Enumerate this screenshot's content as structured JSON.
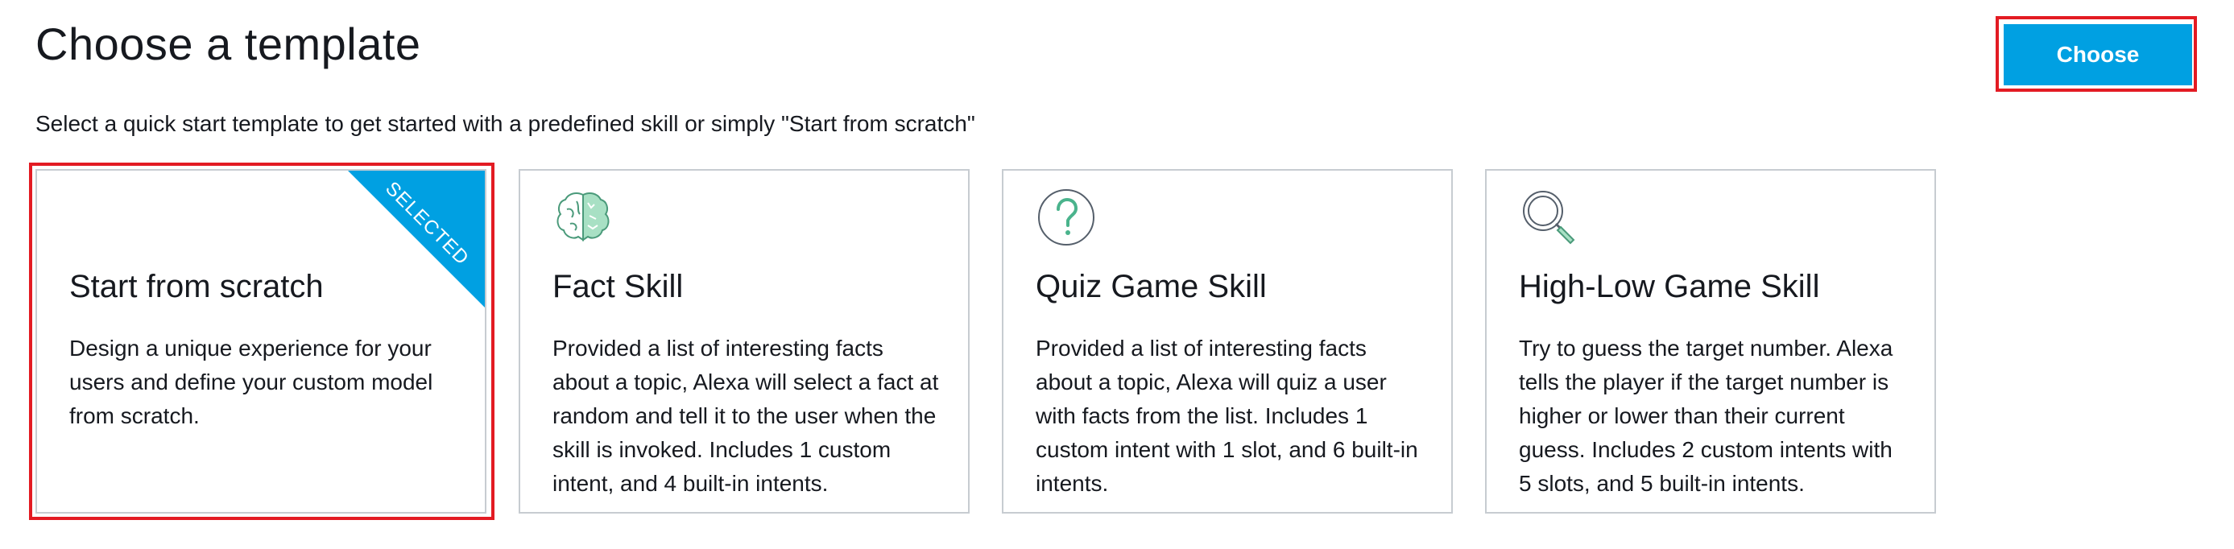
{
  "page": {
    "title": "Choose a template",
    "subtitle": "Select a quick start template to get started with a predefined skill or simply \"Start from scratch\""
  },
  "actions": {
    "choose_label": "Choose"
  },
  "colors": {
    "accent": "#00a0e2",
    "highlight": "#e31b23",
    "card_border": "#c7ccd1"
  },
  "templates": [
    {
      "title": "Start from scratch",
      "description": "Design a unique experience for your users and define your custom model from scratch.",
      "badge": "SELECTED",
      "selected": true,
      "icon": "none"
    },
    {
      "title": "Fact Skill",
      "description": "Provided a list of interesting facts about a topic, Alexa will select a fact at random and tell it to the user when the skill is invoked. Includes 1 custom intent, and 4 built-in intents.",
      "icon": "brain-icon"
    },
    {
      "title": "Quiz Game Skill",
      "description": "Provided a list of interesting facts about a topic, Alexa will quiz a user with facts from the list. Includes 1 custom intent with 1 slot, and 6 built-in intents.",
      "icon": "question-icon"
    },
    {
      "title": "High-Low Game Skill",
      "description": "Try to guess the target number. Alexa tells the player if the target number is higher or lower than their current guess. Includes 2 custom intents with 5 slots, and 5 built-in intents.",
      "icon": "magnifier-icon"
    }
  ]
}
